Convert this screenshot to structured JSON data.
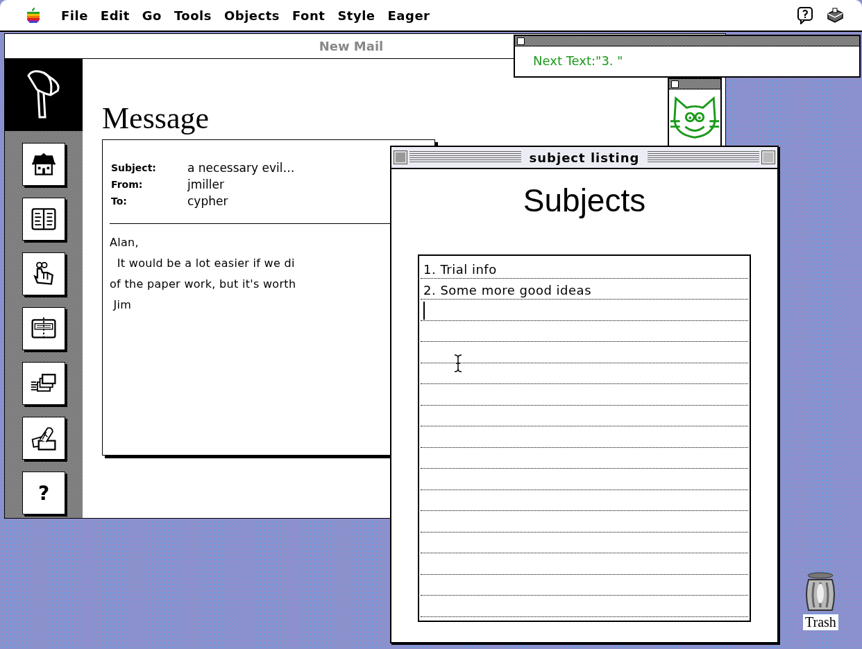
{
  "menu_bar": {
    "menus": [
      "File",
      "Edit",
      "Go",
      "Tools",
      "Objects",
      "Font",
      "Style",
      "Eager"
    ]
  },
  "mail_window": {
    "title": "New Mail",
    "heading": "Message",
    "sidebar": {
      "items": [
        {
          "selected": true
        },
        {
          "selected": false
        },
        {
          "selected": false
        },
        {
          "selected": false
        },
        {
          "selected": false
        },
        {
          "selected": false
        },
        {
          "selected": false
        },
        {
          "selected": false,
          "label": "?"
        }
      ]
    },
    "fields": [
      {
        "label": "Subject:",
        "value": "a necessary evil…"
      },
      {
        "label": "From:",
        "value": "jmiller"
      },
      {
        "label": "To:",
        "value": "cypher"
      }
    ],
    "body": [
      "Alan,",
      "  It would be a lot easier if we di",
      "of the paper work, but it's worth",
      " Jim"
    ]
  },
  "next_text_window": {
    "text": "Next Text:\"3. \""
  },
  "subject_window": {
    "title": "subject listing",
    "heading": "Subjects",
    "rows": [
      "1. Trial info",
      "2. Some more good ideas"
    ]
  },
  "desktop": {
    "trash_label": "Trash"
  }
}
